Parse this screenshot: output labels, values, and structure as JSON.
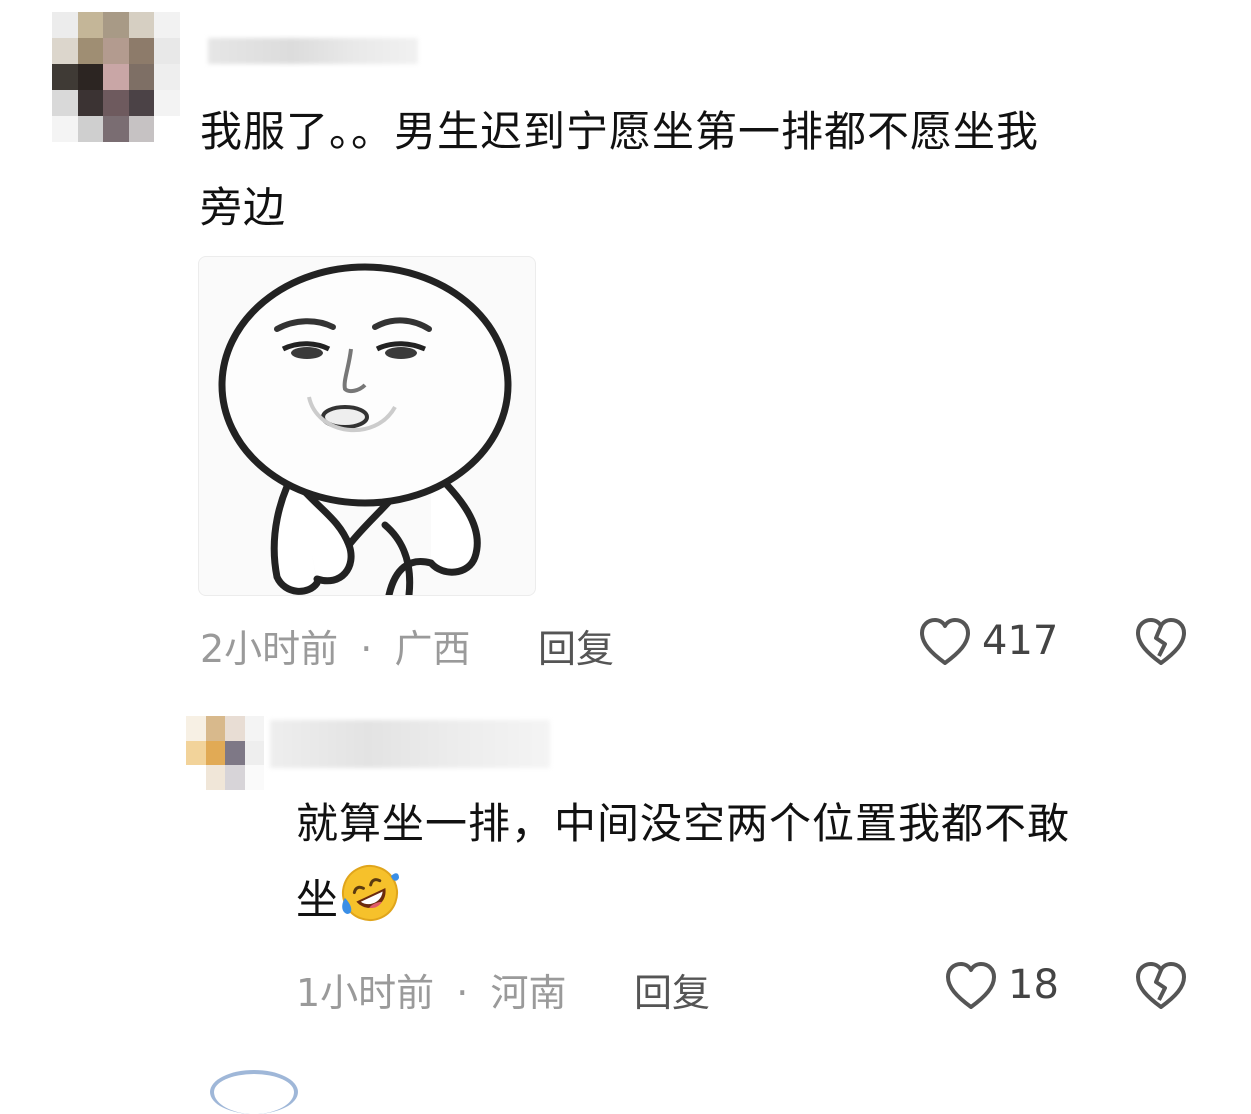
{
  "comments": [
    {
      "text_line1": "我服了。。男生迟到宁愿坐第一排都不愿坐我",
      "text_line2": "旁边",
      "time": "2小时前",
      "separator": "·",
      "location": "广西",
      "reply_label": "回复",
      "like_count": "417",
      "sticker": "meme-face-sticker"
    },
    {
      "text_line1": "就算坐一排，中间没空两个位置我都不敢",
      "text_line2": "坐",
      "emoji": "rolling-laughing-emoji",
      "time": "1小时前",
      "separator": "·",
      "location": "河南",
      "reply_label": "回复",
      "like_count": "18"
    }
  ],
  "icons": {
    "like": "heart-outline-icon",
    "dislike": "broken-heart-icon"
  },
  "colors": {
    "text": "#111111",
    "meta": "#9a9a9a",
    "icon": "#555555",
    "emoji_face": "#f6c12b",
    "emoji_tear": "#3a8ee6"
  }
}
